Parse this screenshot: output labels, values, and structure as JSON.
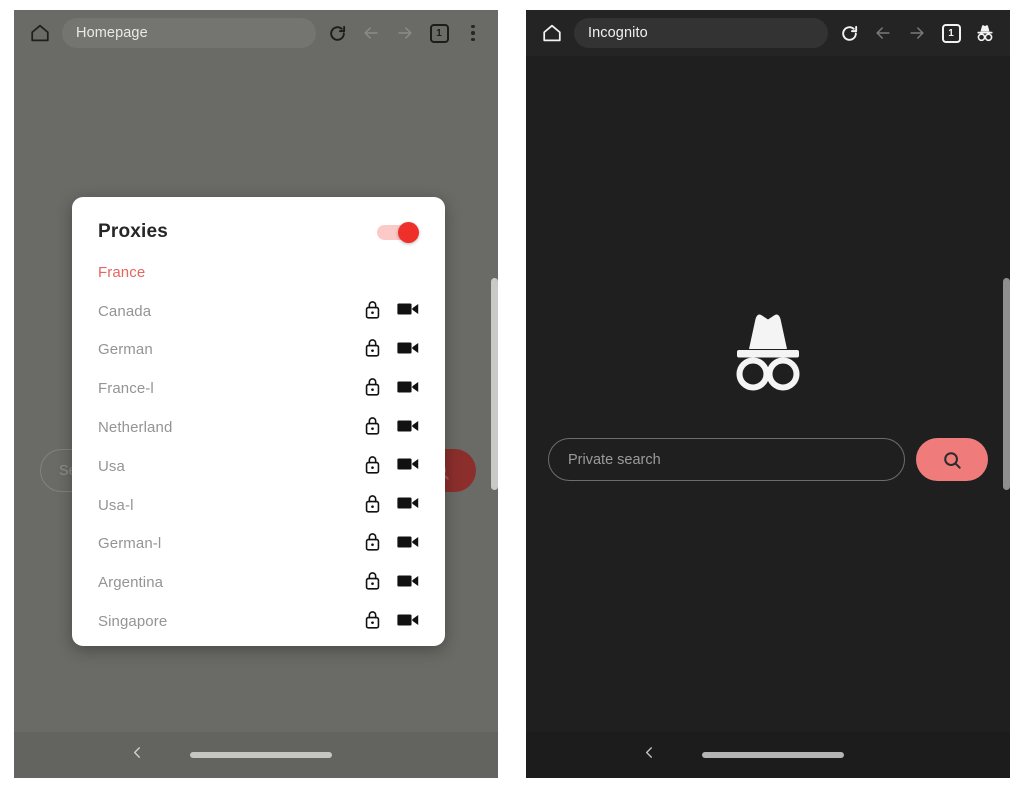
{
  "colors": {
    "accent_red": "#ef2f2a",
    "active_item": "#e8645f",
    "search_button_pink": "#ef7b7b",
    "search_button_dimmed": "#8c2f2c",
    "dim_overlay": "#6a6b66",
    "incognito_bg": "#1f1f1f"
  },
  "left_panel": {
    "toolbar": {
      "home_icon": "home-icon",
      "url_value": "Homepage",
      "reload_icon": "reload-icon",
      "back_icon": "arrow-back-icon",
      "forward_icon": "arrow-forward-icon",
      "tab_count": "1",
      "menu_icon": "kebab-menu-icon"
    },
    "background": {
      "search_placeholder": "Sea",
      "search_button_icon": "search-icon"
    },
    "dialog": {
      "title": "Proxies",
      "toggle": {
        "name": "proxies-toggle",
        "state": "on"
      },
      "items": [
        {
          "label": "France",
          "active": true,
          "lock": false,
          "video": false
        },
        {
          "label": "Canada",
          "active": false,
          "lock": true,
          "video": true
        },
        {
          "label": "German",
          "active": false,
          "lock": true,
          "video": true
        },
        {
          "label": "France-l",
          "active": false,
          "lock": true,
          "video": true
        },
        {
          "label": "Netherland",
          "active": false,
          "lock": true,
          "video": true
        },
        {
          "label": "Usa",
          "active": false,
          "lock": true,
          "video": true
        },
        {
          "label": "Usa-l",
          "active": false,
          "lock": true,
          "video": true
        },
        {
          "label": "German-l",
          "active": false,
          "lock": true,
          "video": true
        },
        {
          "label": "Argentina",
          "active": false,
          "lock": true,
          "video": true
        },
        {
          "label": "Singapore",
          "active": false,
          "lock": true,
          "video": true
        }
      ]
    },
    "navbar": {
      "back_icon": "chevron-back-icon",
      "home_indicator": "home-indicator"
    }
  },
  "right_panel": {
    "toolbar": {
      "home_icon": "home-icon",
      "url_value": "Incognito",
      "reload_icon": "reload-icon",
      "back_icon": "arrow-back-icon",
      "forward_icon": "arrow-forward-icon",
      "tab_count": "1",
      "incognito_icon": "incognito-icon"
    },
    "home": {
      "badge_icon": "incognito-icon",
      "search_placeholder": "Private search",
      "search_button_icon": "search-icon"
    },
    "navbar": {
      "back_icon": "chevron-back-icon",
      "home_indicator": "home-indicator"
    }
  }
}
